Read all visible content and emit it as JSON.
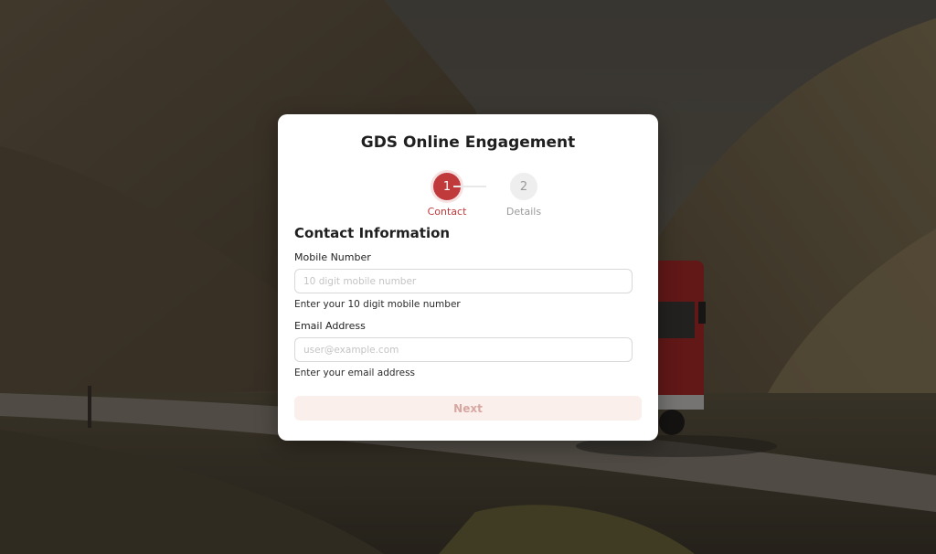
{
  "app": {
    "title": "GDS Online Engagement"
  },
  "stepper": {
    "steps": [
      {
        "number": "1",
        "label": "Contact",
        "state": "active"
      },
      {
        "number": "2",
        "label": "Details",
        "state": "inactive"
      }
    ]
  },
  "form": {
    "section_title": "Contact Information",
    "mobile": {
      "label": "Mobile Number",
      "placeholder": "10 digit mobile number",
      "value": "",
      "helper": "Enter your 10 digit mobile number"
    },
    "email": {
      "label": "Email Address",
      "placeholder": "user@example.com",
      "value": "",
      "helper": "Enter your email address"
    },
    "next_label": "Next"
  },
  "colors": {
    "accent": "#c0393b",
    "disabled_button_bg": "#fbefec",
    "disabled_button_text": "#d7a7a2"
  }
}
